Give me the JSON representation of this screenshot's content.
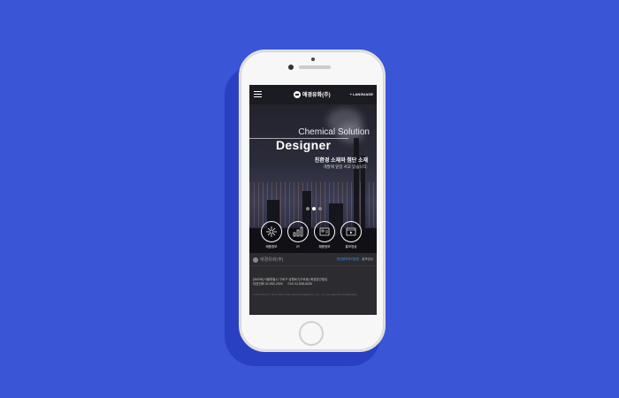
{
  "background_color": "#3a55d6",
  "header": {
    "menu_icon": "hamburger-icon",
    "logo_text": "애경유화(주)",
    "language_label": "+ LANGUAGE"
  },
  "hero": {
    "subtitle": "Chemical Solution",
    "title": "Designer",
    "tagline_main": "친환경 소재와 첨단 소재",
    "tagline_sub": "개발에 앞장 서고 있습니다.",
    "slides_total": 3,
    "slide_active": 2
  },
  "quick_links": [
    {
      "label": "제품정보",
      "icon": "atom-icon"
    },
    {
      "label": "IR",
      "icon": "chart-icon"
    },
    {
      "label": "채용정보",
      "icon": "people-icon"
    },
    {
      "label": "홍보영상",
      "icon": "video-icon"
    }
  ],
  "footer": {
    "logo_text": "애경유화(주)",
    "privacy_link": "개인정보처리방침",
    "video_link": "홍보영상",
    "address": "[06298] 서울특별시 구로구 공원로7(구로동) 애경본관빌딩",
    "phone": "대표전화 02-850-2000",
    "fax": "FAX 02-838-8435",
    "copyright": "COPYRIGHT© 2017 AEKYUNG PETROCHEMICAL CO., Ltd. ALL RIGHTS RESERVED."
  }
}
